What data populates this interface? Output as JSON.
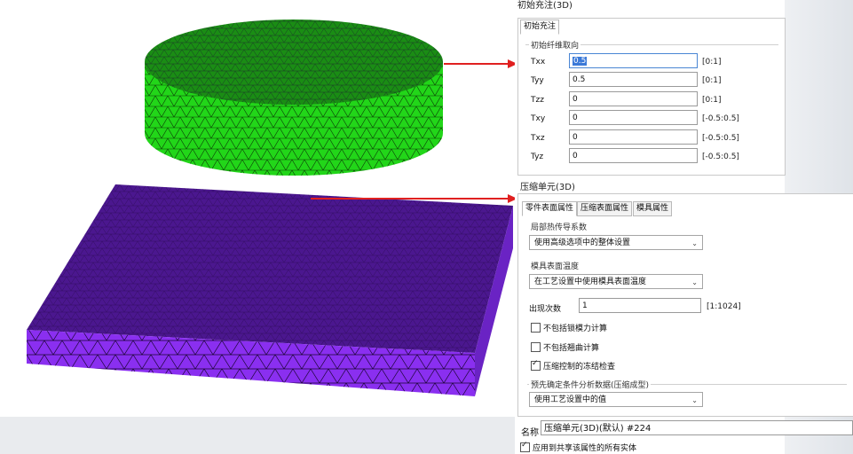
{
  "fill_panel": {
    "title": "初始充注(3D)",
    "tab": "初始充注",
    "group": "初始纤维取向",
    "rows": [
      {
        "label": "Txx",
        "value": "0.5",
        "range": "[0:1]"
      },
      {
        "label": "Tyy",
        "value": "0.5",
        "range": "[0:1]"
      },
      {
        "label": "Tzz",
        "value": "0",
        "range": "[0:1]"
      },
      {
        "label": "Txy",
        "value": "0",
        "range": "[-0.5:0.5]"
      },
      {
        "label": "Txz",
        "value": "0",
        "range": "[-0.5:0.5]"
      },
      {
        "label": "Tyz",
        "value": "0",
        "range": "[-0.5:0.5]"
      }
    ]
  },
  "compression_panel": {
    "title": "压缩单元(3D)",
    "tabs": [
      "零件表面属性",
      "压缩表面属性",
      "模具属性"
    ],
    "heat_group": "局部热传导系数",
    "heat_select": "使用高级选项中的整体设置",
    "mold_group": "模具表面温度",
    "mold_select": "在工艺设置中使用模具表面温度",
    "occurrence_label": "出现次数",
    "occurrence_value": "1",
    "occurrence_range": "[1:1024]",
    "check_clamp": "不包括锁模力计算",
    "check_warp": "不包括翘曲计算",
    "check_freeze": "压缩控制的冻结检查",
    "predef_group": "预先确定条件分析数据(压缩成型)",
    "predef_select": "使用工艺设置中的值",
    "name_label": "名称",
    "name_value": "压缩单元(3D)(默认) #224",
    "apply_all": "应用到共享该属性的所有实体"
  },
  "colors": {
    "cylinder": "#22d619",
    "plate": "#5a1fa6",
    "arrow": "#e02020"
  }
}
